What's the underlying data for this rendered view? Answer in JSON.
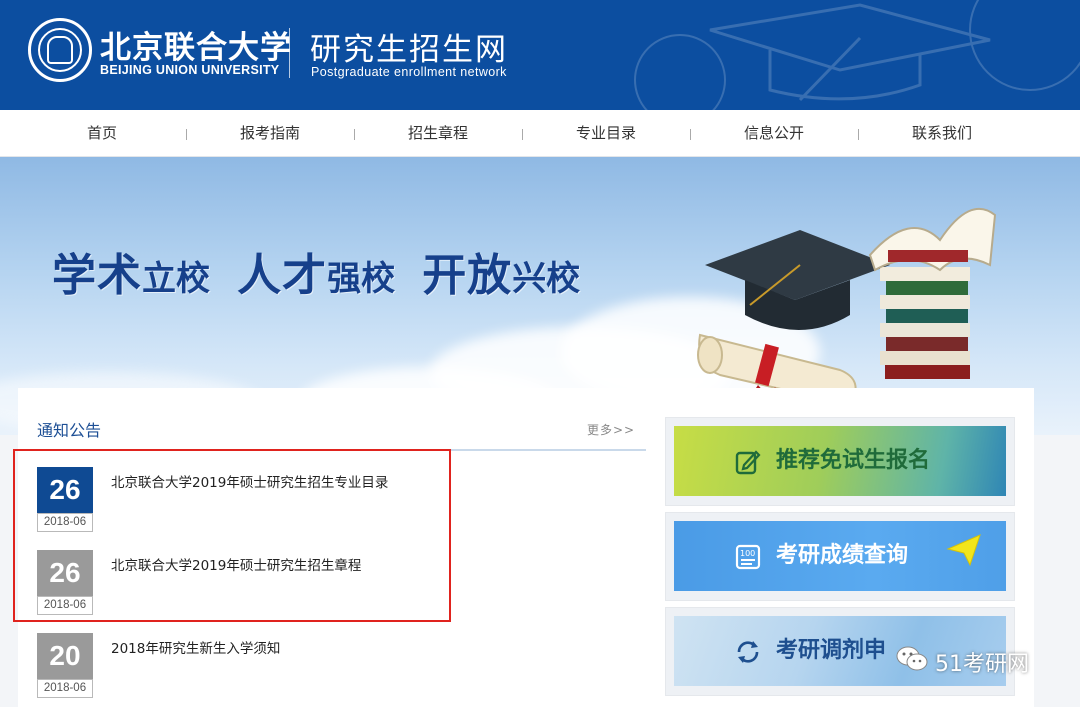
{
  "header": {
    "university_cn": "北京联合大学",
    "university_en": "BEIJING UNION UNIVERSITY",
    "site_cn": "研究生招生网",
    "site_en": "Postgraduate enrollment network"
  },
  "nav": {
    "items": [
      {
        "label": "首页"
      },
      {
        "label": "报考指南"
      },
      {
        "label": "招生章程"
      },
      {
        "label": "专业目录"
      },
      {
        "label": "信息公开"
      },
      {
        "label": "联系我们"
      }
    ]
  },
  "banner": {
    "slogan": [
      {
        "big": "学术",
        "small": "立校"
      },
      {
        "big": "人才",
        "small": "强校"
      },
      {
        "big": "开放",
        "small": "兴校"
      }
    ]
  },
  "notices": {
    "title": "通知公告",
    "more": "更多>>",
    "items": [
      {
        "day": "26",
        "month": "2018-06",
        "title": "北京联合大学2019年硕士研究生招生专业目录",
        "color": "#0f4a93"
      },
      {
        "day": "26",
        "month": "2018-06",
        "title": "北京联合大学2019年硕士研究生招生章程",
        "color": "#9a9a9a"
      },
      {
        "day": "20",
        "month": "2018-06",
        "title": "2018年研究生新生入学须知",
        "color": "#9a9a9a"
      }
    ]
  },
  "quick_links": [
    {
      "label": "推荐免试生报名",
      "icon": "edit-icon",
      "text_color": "#1f6b3a"
    },
    {
      "label": "考研成绩查询",
      "icon": "score-icon",
      "text_color": "#ffffff"
    },
    {
      "label": "考研调剂申",
      "icon": "refresh-icon",
      "text_color": "#1e4f8f"
    }
  ],
  "watermark": {
    "text": "51考研网",
    "icon": "wechat-icon"
  },
  "colors": {
    "header_bg": "#0c4ea0",
    "accent_blue": "#1d4f95",
    "highlight_red": "#e0231e"
  }
}
